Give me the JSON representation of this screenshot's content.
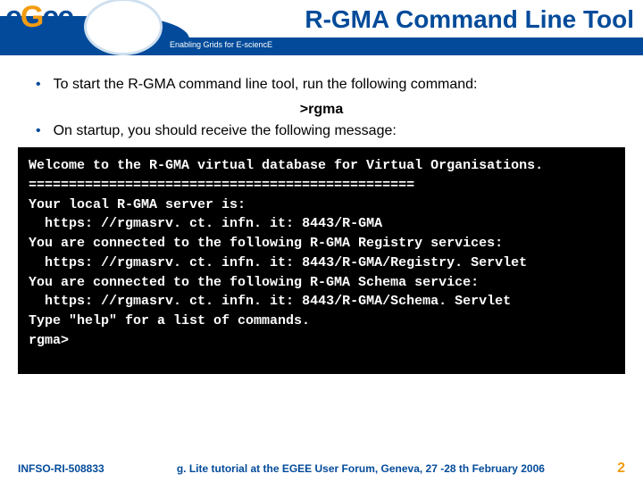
{
  "header": {
    "logo_e": "e",
    "logo_g": "G",
    "logo_ee": "ee",
    "title": "R-GMA Command Line Tool",
    "tagline": "Enabling Grids for E-sciencE"
  },
  "content": {
    "bullet1": "To start the R-GMA command line tool, run the following command:",
    "command": ">rgma",
    "bullet2": "On startup, you should receive the following message:"
  },
  "terminal": {
    "text": "Welcome to the R-GMA virtual database for Virtual Organisations.\n================================================\nYour local R-GMA server is:\n  https: //rgmasrv. ct. infn. it: 8443/R-GMA\nYou are connected to the following R-GMA Registry services:\n  https: //rgmasrv. ct. infn. it: 8443/R-GMA/Registry. Servlet\nYou are connected to the following R-GMA Schema service:\n  https: //rgmasrv. ct. infn. it: 8443/R-GMA/Schema. Servlet\nType \"help\" for a list of commands.\nrgma>"
  },
  "footer": {
    "left": "INFSO-RI-508833",
    "center": "g. Lite tutorial at the EGEE User Forum, Geneva, 27 -28 th  February 2006",
    "right": "2"
  }
}
